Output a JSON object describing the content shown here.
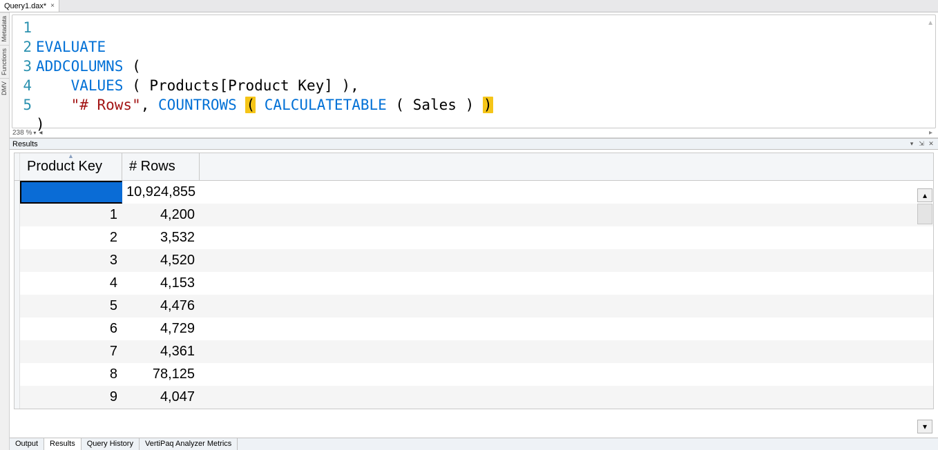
{
  "tab": {
    "label": "Query1.dax*",
    "close": "×"
  },
  "sidebar": {
    "items": [
      "Metadata",
      "Functions",
      "DMV"
    ]
  },
  "editor": {
    "lines": [
      "1",
      "2",
      "3",
      "4",
      "5"
    ],
    "code": {
      "line1_evaluate": "EVALUATE",
      "line2_addcolumns": "ADDCOLUMNS",
      "line2_openparen": "(",
      "line3_values": "VALUES",
      "line3_args": " ( Products[Product Key] ),",
      "line4_rows_label": "\"# Rows\"",
      "line4_comma": ", ",
      "line4_countrows": "COUNTROWS",
      "line4_hlparen_open": "(",
      "line4_calc": " CALCULATETABLE",
      "line4_rest": " ( Sales ) ",
      "line4_hlparen_close": ")",
      "line5_closeparen": ")"
    },
    "zoom": "238 %"
  },
  "results": {
    "panel_title": "Results",
    "columns": [
      "Product Key",
      "# Rows"
    ],
    "rows": [
      {
        "pk": "",
        "rows": "10,924,855",
        "selected": true
      },
      {
        "pk": "1",
        "rows": "4,200"
      },
      {
        "pk": "2",
        "rows": "3,532"
      },
      {
        "pk": "3",
        "rows": "4,520"
      },
      {
        "pk": "4",
        "rows": "4,153"
      },
      {
        "pk": "5",
        "rows": "4,476"
      },
      {
        "pk": "6",
        "rows": "4,729"
      },
      {
        "pk": "7",
        "rows": "4,361"
      },
      {
        "pk": "8",
        "rows": "78,125"
      },
      {
        "pk": "9",
        "rows": "4,047"
      }
    ],
    "toolwindow_icons": {
      "dropdown": "▾",
      "pin": "⇲",
      "close": "✕"
    }
  },
  "bottom_tabs": [
    "Output",
    "Results",
    "Query History",
    "VertiPaq Analyzer Metrics"
  ],
  "bottom_active": "Results"
}
